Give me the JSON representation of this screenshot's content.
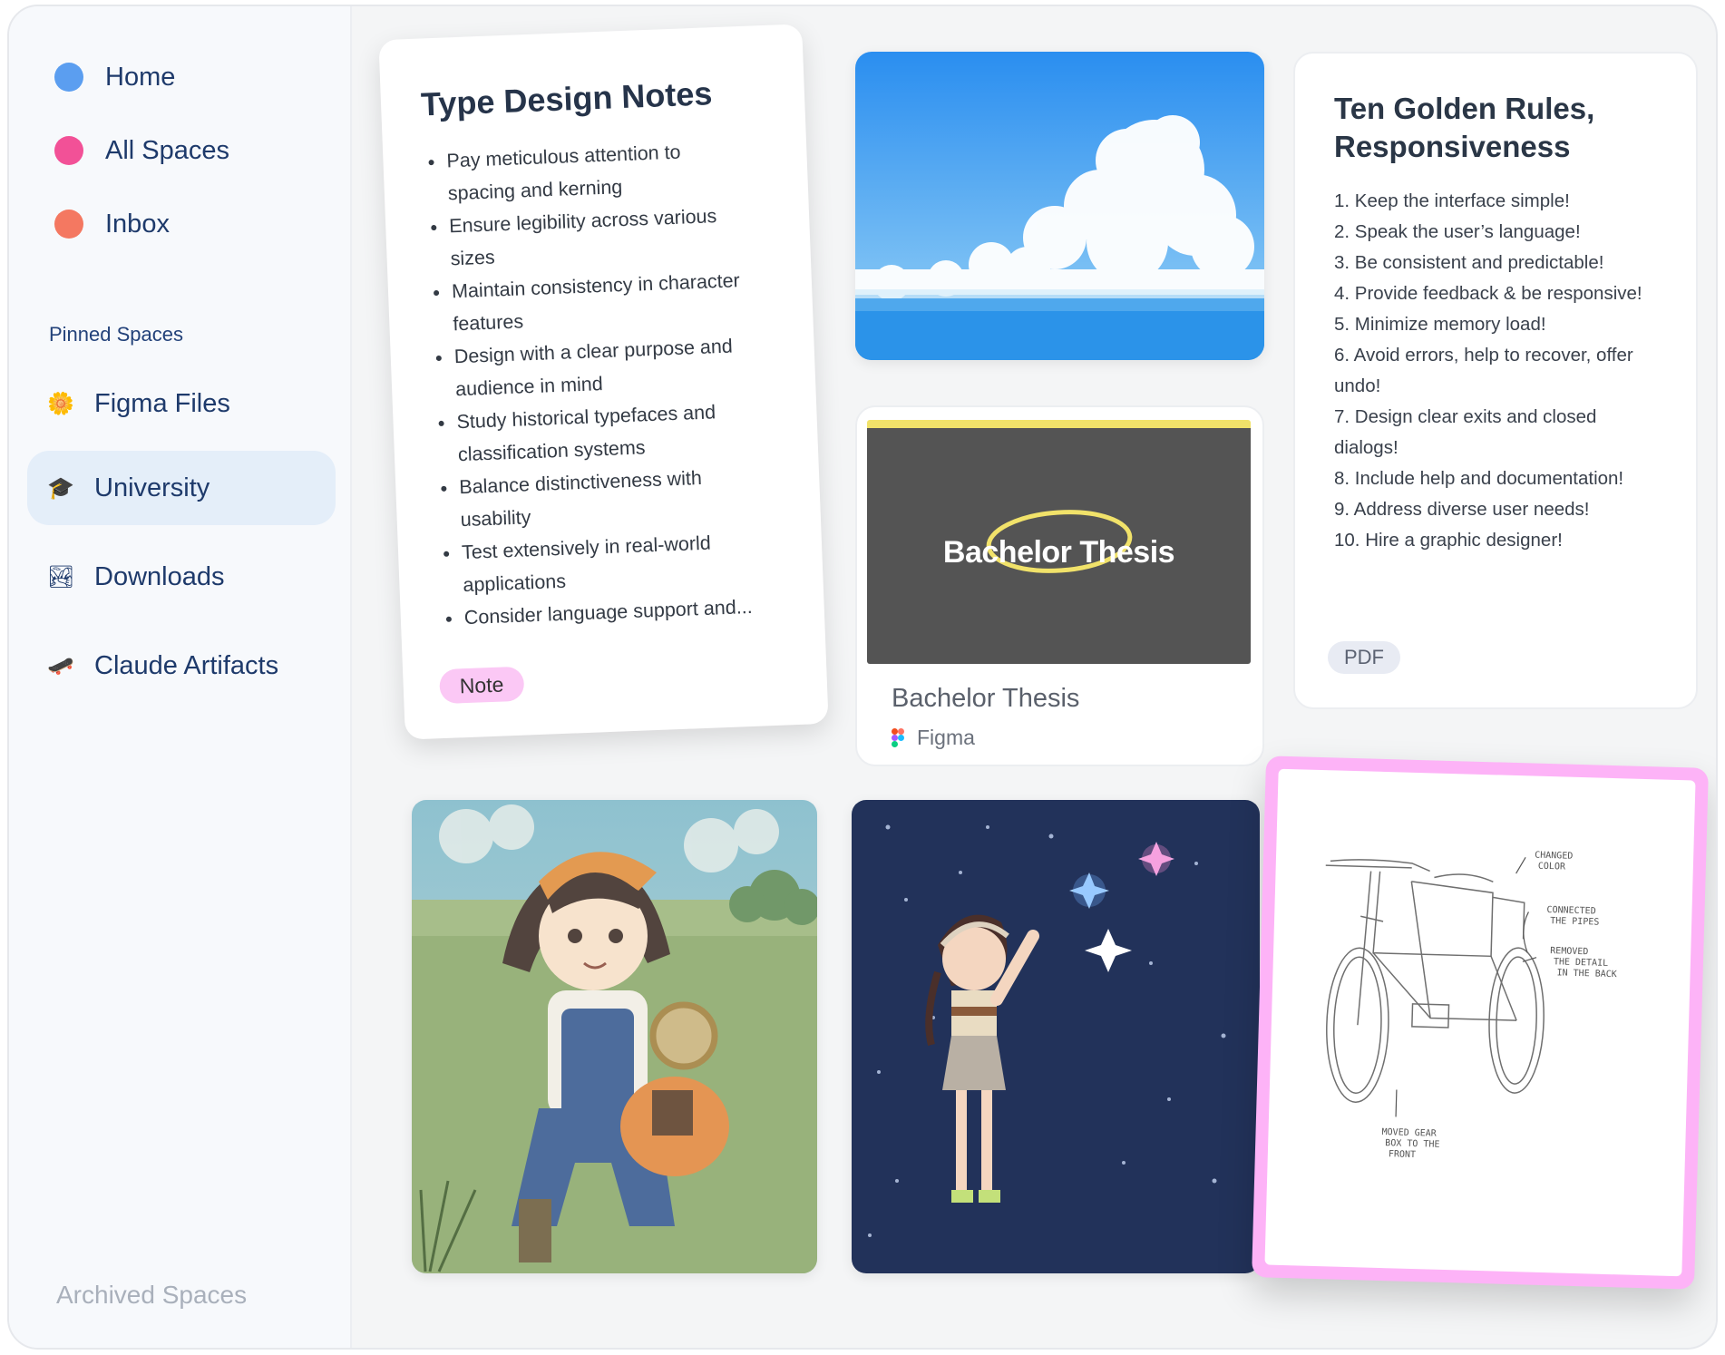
{
  "sidebar": {
    "nav": [
      {
        "label": "Home",
        "color": "#5b9ef0"
      },
      {
        "label": "All Spaces",
        "color": "#f25197"
      },
      {
        "label": "Inbox",
        "color": "#f47861"
      }
    ],
    "pinned_label": "Pinned Spaces",
    "pinned": [
      {
        "label": "Figma Files",
        "icon": "sunflower-icon",
        "emoji": "🌼"
      },
      {
        "label": "University",
        "icon": "graduation-cap-icon",
        "emoji": "🎓",
        "active": true
      },
      {
        "label": "Downloads",
        "icon": "landscape-picture-icon",
        "emoji": "🏞"
      },
      {
        "label": "Claude Artifacts",
        "icon": "skateboard-icon",
        "emoji": "🛹"
      }
    ],
    "archived_label": "Archived Spaces"
  },
  "note": {
    "title": "Type Design Notes",
    "items": [
      "Pay meticulous attention to spacing and kerning",
      "Ensure legibility across various sizes",
      "Maintain consistency in character features",
      "Design with a clear purpose and audience in mind",
      "Study historical typefaces and classification systems",
      "Balance distinctiveness with usability",
      "Test extensively in real-world applications",
      "Consider language support and..."
    ],
    "tag": "Note",
    "tag_color": "#fbc8f5"
  },
  "rules": {
    "title": "Ten Golden Rules, Responsiveness",
    "items": [
      "1. Keep the interface simple!",
      "2. Speak the user’s language!",
      "3. Be consistent and predictable!",
      "4. Provide feedback & be responsive!",
      "5. Minimize memory load!",
      "6. Avoid errors, help to recover, offer undo!",
      "7. Design clear exits and closed dialogs!",
      "8. Include help and documentation!",
      "9. Address diverse user needs!",
      "10. Hire a graphic designer!"
    ],
    "tag": "PDF"
  },
  "thesis": {
    "thumb_text": "Bachelor Thesis",
    "name": "Bachelor Thesis",
    "source": "Figma",
    "accent": "#f1e26a"
  },
  "sketch": {
    "annotations": [
      "CHANGED COLOR",
      "CONNECTED THE PIPES",
      "REMOVED THE DETAIL IN THE BACK",
      "MOVED GEAR BOX TO THE FRONT"
    ],
    "frame_color": "#fdb3f7"
  }
}
